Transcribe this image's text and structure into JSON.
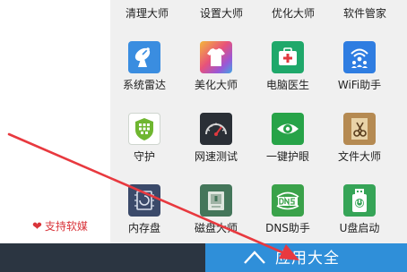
{
  "top_row": [
    "清理大师",
    "设置大师",
    "优化大师",
    "软件管家"
  ],
  "grid": [
    {
      "label": "系统雷达",
      "icon": "radar-dish-icon",
      "color": "#3a8de0"
    },
    {
      "label": "美化大师",
      "icon": "tshirt-icon",
      "color": "#e8527a"
    },
    {
      "label": "电脑医生",
      "icon": "medical-kit-icon",
      "color": "#1fa86a"
    },
    {
      "label": "WiFi助手",
      "icon": "wifi-people-icon",
      "color": "#2f7de1"
    },
    {
      "label": "守护",
      "icon": "shield-grid-icon",
      "color": "#6fb630"
    },
    {
      "label": "网速测试",
      "icon": "speedometer-icon",
      "color": "#2a2f36"
    },
    {
      "label": "一键护眼",
      "icon": "eye-icon",
      "color": "#27a348"
    },
    {
      "label": "文件大师",
      "icon": "file-scissors-icon",
      "color": "#b58a52"
    },
    {
      "label": "内存盘",
      "icon": "memory-chip-icon",
      "color": "#3b4a6a"
    },
    {
      "label": "磁盘大师",
      "icon": "disk-safe-icon",
      "color": "#44765a"
    },
    {
      "label": "DNS助手",
      "icon": "dns-icon",
      "color": "#3aa24a"
    },
    {
      "label": "U盘启动",
      "icon": "usb-drive-icon",
      "color": "#36a457"
    }
  ],
  "support": {
    "label": "支持软媒",
    "icon": "heart-icon",
    "color": "#d9343a"
  },
  "apps_button": {
    "label": "应用大全",
    "icon": "up-arrow-icon",
    "color": "#2f8fd9"
  },
  "annotation_color": "#e8393f"
}
